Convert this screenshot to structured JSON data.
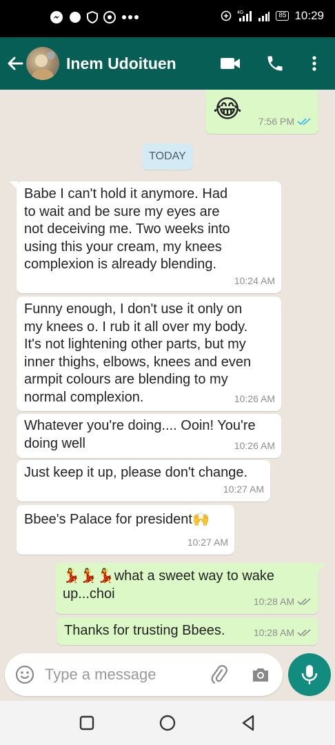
{
  "status_bar": {
    "time": "10:29",
    "battery": "85",
    "network": "4G"
  },
  "header": {
    "contact_name": "Inem Udoituen",
    "color": "#075e54"
  },
  "chat": {
    "date_divider": "TODAY",
    "messages": [
      {
        "direction": "outgoing",
        "text": "😂",
        "time": "7:56 PM",
        "status": "read"
      },
      {
        "direction": "incoming",
        "lines": [
          "Babe I can't hold it anymore. Had",
          "to wait and be sure my eyes are",
          "not deceiving me. Two weeks into",
          "using this your cream, my knees",
          "complexion is already blending."
        ],
        "time": "10:24 AM"
      },
      {
        "direction": "incoming",
        "lines": [
          "Funny enough, I don't use it only on",
          "my knees o. I rub it all over my body.",
          "It's not lightening other parts, but my",
          "inner thighs, elbows, knees and even",
          "armpit colours are blending to my",
          "normal complexion."
        ],
        "time": "10:26 AM"
      },
      {
        "direction": "incoming",
        "lines": [
          "Whatever you're doing.... Ooin! You're",
          "doing well"
        ],
        "time": "10:26 AM"
      },
      {
        "direction": "incoming",
        "lines": [
          "Just keep it up, please don't change."
        ],
        "time": "10:27 AM"
      },
      {
        "direction": "incoming",
        "text": "Bbee's Palace for president🙌",
        "time": "10:27 AM"
      },
      {
        "direction": "outgoing",
        "lines": [
          "💃💃💃what a sweet way to wake",
          "up...choi"
        ],
        "time": "10:28 AM",
        "status": "delivered"
      },
      {
        "direction": "outgoing",
        "text": "Thanks for trusting Bbees.",
        "time": "10:28 AM",
        "status": "delivered"
      }
    ]
  },
  "input": {
    "placeholder": "Type a message"
  },
  "colors": {
    "incoming_bubble": "#ffffff",
    "outgoing_bubble": "#dcf8c6",
    "read_ticks": "#34b7f1",
    "mic_button": "#128c7e"
  }
}
